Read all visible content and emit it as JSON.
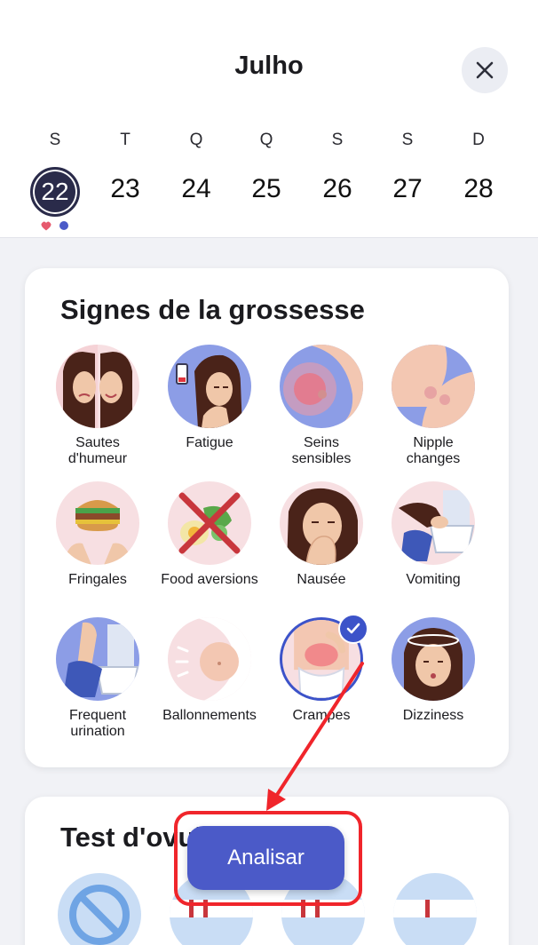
{
  "header": {
    "month_title": "Julho",
    "close_icon": "close-icon"
  },
  "week": {
    "weekdays": [
      "S",
      "T",
      "Q",
      "Q",
      "S",
      "S",
      "D"
    ],
    "days": [
      "22",
      "23",
      "24",
      "25",
      "26",
      "27",
      "28"
    ],
    "selected_day": "22",
    "markers": [
      {
        "icon": "heart-icon",
        "color": "#e65a6e"
      },
      {
        "icon": "dot-icon",
        "color": "#4b5ac8"
      }
    ]
  },
  "pregnancy_card": {
    "title": "Signes de la grossesse",
    "symptoms": [
      {
        "label": "Sautes\nd'humeur",
        "selected": false
      },
      {
        "label": "Fatigue",
        "selected": false
      },
      {
        "label": "Seins\nsensibles",
        "selected": false
      },
      {
        "label": "Nipple\nchanges",
        "selected": false
      },
      {
        "label": "Fringales",
        "selected": false
      },
      {
        "label": "Food aversions",
        "selected": false
      },
      {
        "label": "Nausée",
        "selected": false
      },
      {
        "label": "Vomiting",
        "selected": false
      },
      {
        "label": "Frequent\nurination",
        "selected": false
      },
      {
        "label": "Ballonnements",
        "selected": false
      },
      {
        "label": "Crampes",
        "selected": true
      },
      {
        "label": "Dizziness",
        "selected": false
      }
    ]
  },
  "ovulation_card": {
    "title": "Test d'ovulation"
  },
  "actions": {
    "analyze_label": "Analisar"
  },
  "colors": {
    "accent": "#4b5ac8",
    "annotation": "#f0252b",
    "selected_day_bg": "#2a2b4a"
  }
}
